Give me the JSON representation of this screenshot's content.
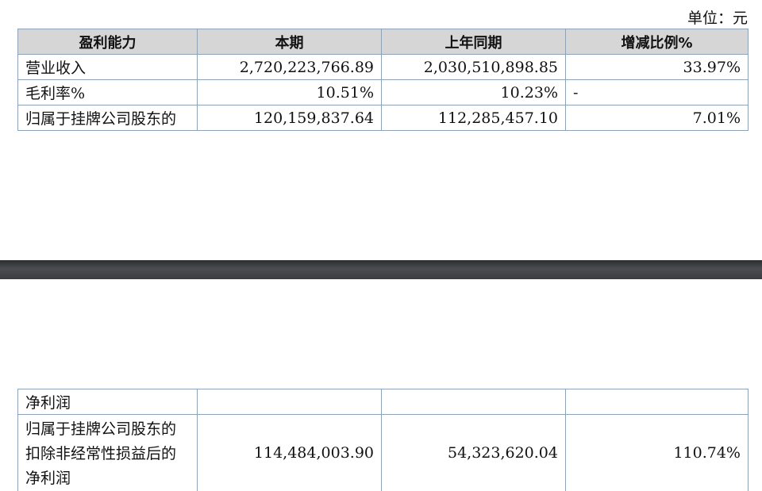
{
  "unit": "单位：元",
  "table1": {
    "headers": [
      "盈利能力",
      "本期",
      "上年同期",
      "增减比例%"
    ],
    "rows": [
      [
        "营业收入",
        "2,720,223,766.89",
        "2,030,510,898.85",
        "33.97%"
      ],
      [
        "毛利率%",
        "10.51%",
        "10.23%",
        "-"
      ],
      [
        "归属于挂牌公司股东的",
        "120,159,837.64",
        "112,285,457.10",
        "7.01%"
      ]
    ]
  },
  "table2": {
    "rows": [
      [
        "净利润",
        "",
        "",
        ""
      ],
      [
        "归属于挂牌公司股东的扣除非经常性损益后的净利润",
        "114,484,003.90",
        "54,323,620.04",
        "110.74%"
      ]
    ]
  }
}
